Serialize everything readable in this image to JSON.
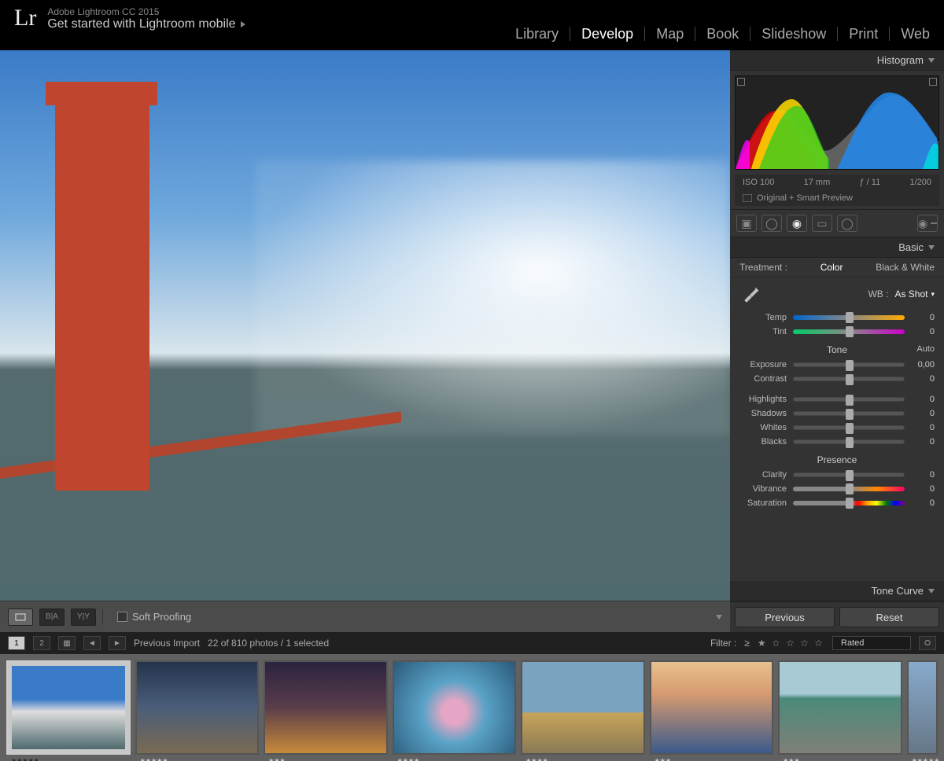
{
  "header": {
    "app_title": "Adobe Lightroom CC 2015",
    "subtitle": "Get started with Lightroom mobile",
    "modules": [
      "Library",
      "Develop",
      "Map",
      "Book",
      "Slideshow",
      "Print",
      "Web"
    ],
    "active_module": "Develop"
  },
  "panels": {
    "histogram_label": "Histogram",
    "histogram_meta": {
      "iso": "ISO 100",
      "focal": "17 mm",
      "aperture": "ƒ / 11",
      "shutter": "1/200"
    },
    "preview_mode": "Original + Smart Preview",
    "basic_label": "Basic",
    "treatment_label": "Treatment :",
    "treatment_color": "Color",
    "treatment_bw": "Black & White",
    "wb_label": "WB :",
    "wb_value": "As Shot",
    "tone_label": "Tone",
    "auto_label": "Auto",
    "presence_label": "Presence",
    "tone_curve_label": "Tone Curve",
    "sliders": {
      "temp": {
        "label": "Temp",
        "value": "0"
      },
      "tint": {
        "label": "Tint",
        "value": "0"
      },
      "exposure": {
        "label": "Exposure",
        "value": "0,00"
      },
      "contrast": {
        "label": "Contrast",
        "value": "0"
      },
      "highlights": {
        "label": "Highlights",
        "value": "0"
      },
      "shadows": {
        "label": "Shadows",
        "value": "0"
      },
      "whites": {
        "label": "Whites",
        "value": "0"
      },
      "blacks": {
        "label": "Blacks",
        "value": "0"
      },
      "clarity": {
        "label": "Clarity",
        "value": "0"
      },
      "vibrance": {
        "label": "Vibrance",
        "value": "0"
      },
      "saturation": {
        "label": "Saturation",
        "value": "0"
      }
    },
    "previous_btn": "Previous",
    "reset_btn": "Reset"
  },
  "toolbar": {
    "soft_proofing": "Soft Proofing"
  },
  "filmbar": {
    "page1": "1",
    "page2": "2",
    "source": "Previous Import",
    "count": "22 of 810 photos / 1 selected",
    "filter_label": "Filter :",
    "compare": "≥",
    "filter_value": "Rated"
  },
  "thumbs": [
    {
      "rating": "★★★★★"
    },
    {
      "rating": "★★★★★"
    },
    {
      "rating": "★★★"
    },
    {
      "rating": "★★★★"
    },
    {
      "rating": "★★★★"
    },
    {
      "rating": "★★★"
    },
    {
      "rating": "★★★"
    },
    {
      "rating": "★★★★★"
    }
  ]
}
